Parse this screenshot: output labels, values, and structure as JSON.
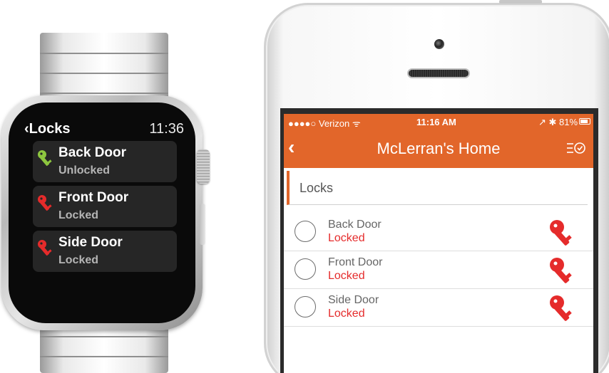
{
  "colors": {
    "accent": "#e2662a",
    "locked_red": "#e52b2b",
    "unlocked_green": "#8dc63f"
  },
  "watch": {
    "back_label": "Locks",
    "time": "11:36",
    "locks": [
      {
        "name": "Back Door",
        "status": "Unlocked",
        "icon": "key-icon-green"
      },
      {
        "name": "Front Door",
        "status": "Locked",
        "icon": "key-icon-red"
      },
      {
        "name": "Side Door",
        "status": "Locked",
        "icon": "key-icon-red"
      }
    ]
  },
  "phone": {
    "status_bar": {
      "carrier": "●●●●○ Verizon ᯤ",
      "time": "11:16 AM",
      "right": "↗ ✱ 81%"
    },
    "nav": {
      "back_icon": "‹",
      "title": "McLerran's Home",
      "menu_icon": "list-clock-icon"
    },
    "section_label": "Locks",
    "locks": [
      {
        "name": "Back Door",
        "status": "Locked"
      },
      {
        "name": "Front Door",
        "status": "Locked"
      },
      {
        "name": "Side Door",
        "status": "Locked"
      }
    ]
  }
}
